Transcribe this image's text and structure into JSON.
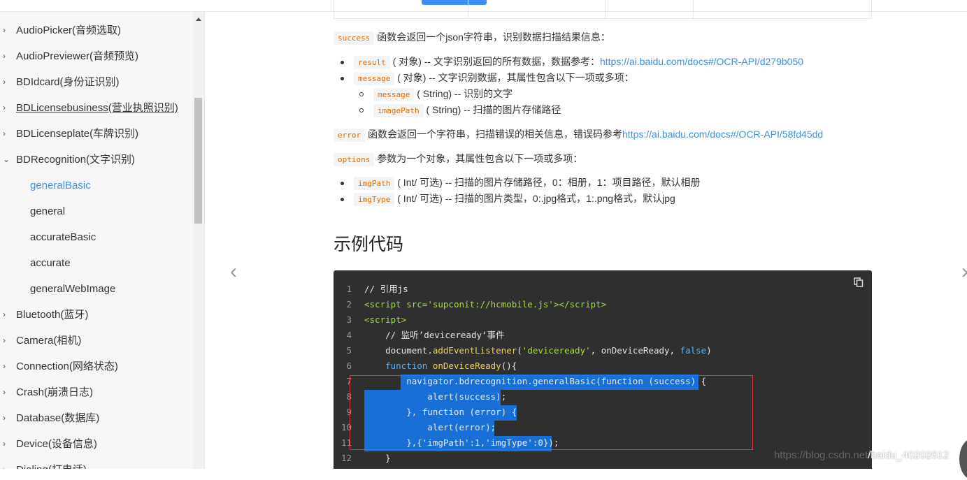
{
  "sidebar": {
    "items": [
      {
        "label": "AudioPicker(音频选取)",
        "chevron": "›"
      },
      {
        "label": "AudioPreviewer(音频预览)",
        "chevron": "›"
      },
      {
        "label": "BDIdcard(身份证识别)",
        "chevron": "›"
      },
      {
        "label": "BDLicensebusiness(营业执照识别)",
        "chevron": "›"
      },
      {
        "label": "BDLicenseplate(车牌识别)",
        "chevron": "›"
      },
      {
        "label": "BDRecognition(文字识别)",
        "chevron": "⌄"
      },
      {
        "label": "generalBasic"
      },
      {
        "label": "general"
      },
      {
        "label": "accurateBasic"
      },
      {
        "label": "accurate"
      },
      {
        "label": "generalWebImage"
      },
      {
        "label": "Bluetooth(蓝牙)",
        "chevron": "›"
      },
      {
        "label": "Camera(相机)",
        "chevron": "›"
      },
      {
        "label": "Connection(网络状态)",
        "chevron": "›"
      },
      {
        "label": "Crash(崩溃日志)",
        "chevron": "›"
      },
      {
        "label": "Database(数据库)",
        "chevron": "›"
      },
      {
        "label": "Device(设备信息)",
        "chevron": "›"
      },
      {
        "label": "Dialing(打电话)",
        "chevron": "›"
      }
    ]
  },
  "content": {
    "success_code": "success",
    "success_text": "函数会返回一个json字符串，识别数据扫描结果信息：",
    "result_code": "result",
    "result_text": "( 对象) -- 文字识别返回的所有数据，数据参考：",
    "result_link": "https://ai.baidu.com/docs#/OCR-API/d279b050",
    "message_code": "message",
    "message_text": "( 对象) -- 文字识别数据，其属性包含以下一项或多项：",
    "sub_message_code": "message",
    "sub_message_text": "( String) -- 识别的文字",
    "imagepath_code": "imagePath",
    "imagepath_text": "( String) -- 扫描的图片存储路径",
    "error_code": "error",
    "error_text": "函数会返回一个字符串，扫描错误的相关信息，错误码参考",
    "error_link": "https://ai.baidu.com/docs#/OCR-API/58fd45dd",
    "options_code": "options",
    "options_text": "参数为一个对象，其属性包含以下一项或多项：",
    "imgpath_code": "imgPath",
    "imgpath_text": "( Int/ 可选) -- 扫描的图片存储路径，0：相册，1：项目路径，默认相册",
    "imgtype_code": "imgType",
    "imgtype_text": "( Int/ 可选) -- 扫描的图片类型，0:.jpg格式，1:.png格式，默认jpg",
    "section_title": "示例代码"
  },
  "code": {
    "line_numbers": [
      "1",
      "2",
      "3",
      "4",
      "5",
      "6",
      "7",
      "8",
      "9",
      "10",
      "11",
      "12"
    ]
  },
  "nav": {
    "prev_arrow": "‹",
    "next_arrow": "›"
  },
  "watermark": {
    "prefix": "https://blog.csdn.net",
    "suffix": "/baidu_40202612"
  },
  "colors": {
    "accent": "#3d8ee6",
    "highlight": "#1a6fd6",
    "annotation": "#e3393c"
  }
}
